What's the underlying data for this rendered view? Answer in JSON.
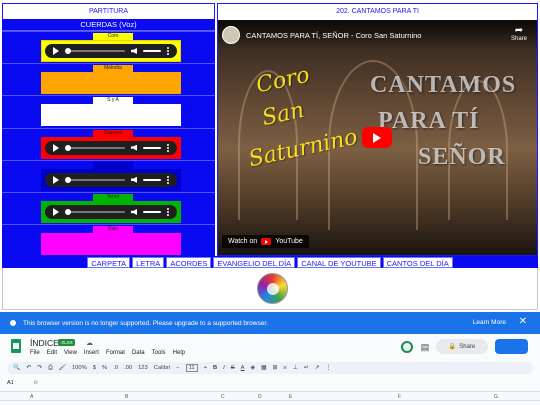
{
  "left_tab": "PARTITURA",
  "right_tab": "202. CANTAMOS PARA TI",
  "left_panel": {
    "title": "CUERDAS (Voz)",
    "slots": [
      {
        "label": "Coro",
        "label_color": "#ffff00",
        "box_color": "#ffff00",
        "border_color": "#e6d300",
        "has_player": true
      },
      {
        "label": "Melodía",
        "label_color": "#ffa500",
        "box_color": "#ffa500",
        "border_color": "#ffa500",
        "has_player": false
      },
      {
        "label": "S y A",
        "label_color": "#ffffff",
        "box_color": "#ffffff",
        "border_color": "#ffffff",
        "has_player": false
      },
      {
        "label": "Soprano",
        "label_color": "#ff0000",
        "box_color": "#ff0000",
        "border_color": "#ff0000",
        "has_player": true
      },
      {
        "label": "",
        "label_color": "#0000cc",
        "box_color": "#0000cc",
        "border_color": "#0000cc",
        "has_player": true
      },
      {
        "label": "Tenor",
        "label_color": "#00b400",
        "box_color": "#00b400",
        "border_color": "#00b400",
        "has_player": true
      },
      {
        "label": "Bajo",
        "label_color": "#ff00ff",
        "box_color": "#ff00ff",
        "border_color": "#ff00ff",
        "has_player": false
      }
    ]
  },
  "video": {
    "title": "CANTAMOS PARA TÍ, SEÑOR - Coro San Saturnino",
    "share": "Share",
    "overlay_lines": [
      "CANTAMOS",
      "PARA  TÍ",
      "SEÑOR"
    ],
    "coro_lines": [
      "Coro",
      "San",
      "Saturnino"
    ],
    "watch_on": "Watch on",
    "youtube": "YouTube"
  },
  "nav": [
    "CARPETA",
    "LETRA",
    "ACORDES",
    "EVANGELIO DEL DÍA",
    "CANAL DE YOUTUBE",
    "CANTOS DEL DÍA"
  ],
  "banner": {
    "text": "This browser version is no longer supported. Please upgrade to a supported browser.",
    "learn_more": "Learn More",
    "close": "✕"
  },
  "sheets": {
    "title": "ÍNDICE",
    "badge": ".XLSX",
    "menu": [
      "File",
      "Edit",
      "View",
      "Insert",
      "Format",
      "Data",
      "Tools",
      "Help"
    ],
    "share": "Share",
    "zoom": "100%",
    "font": "Calibri",
    "font_size": "11",
    "cell_ref": "A1",
    "fx": "fx",
    "columns": [
      "A",
      "B",
      "C",
      "D",
      "E",
      "F",
      "G"
    ]
  }
}
